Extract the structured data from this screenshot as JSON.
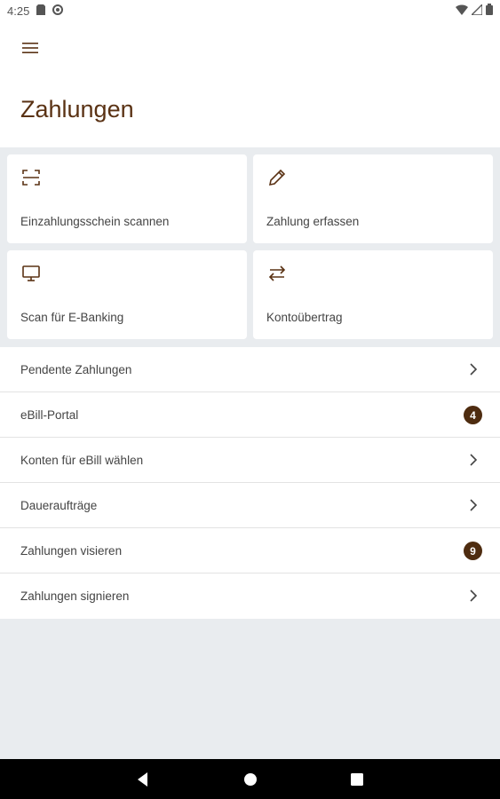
{
  "status_bar": {
    "time": "4:25"
  },
  "header": {
    "title": "Zahlungen"
  },
  "tiles": [
    {
      "label": "Einzahlungsschein scannen",
      "icon": "scan-icon"
    },
    {
      "label": "Zahlung erfassen",
      "icon": "pencil-icon"
    },
    {
      "label": "Scan für E-Banking",
      "icon": "monitor-icon"
    },
    {
      "label": "Kontoübertrag",
      "icon": "transfer-arrows-icon"
    }
  ],
  "list": [
    {
      "label": "Pendente Zahlungen",
      "trailing": "chevron"
    },
    {
      "label": "eBill-Portal",
      "badge": "4"
    },
    {
      "label": "Konten für eBill wählen",
      "trailing": "chevron"
    },
    {
      "label": "Daueraufträge",
      "trailing": "chevron"
    },
    {
      "label": "Zahlungen visieren",
      "badge": "9"
    },
    {
      "label": "Zahlungen signieren",
      "trailing": "chevron"
    }
  ],
  "colors": {
    "accent": "#5a3214",
    "badge": "#4e2c10",
    "background": "#e9ecef"
  }
}
